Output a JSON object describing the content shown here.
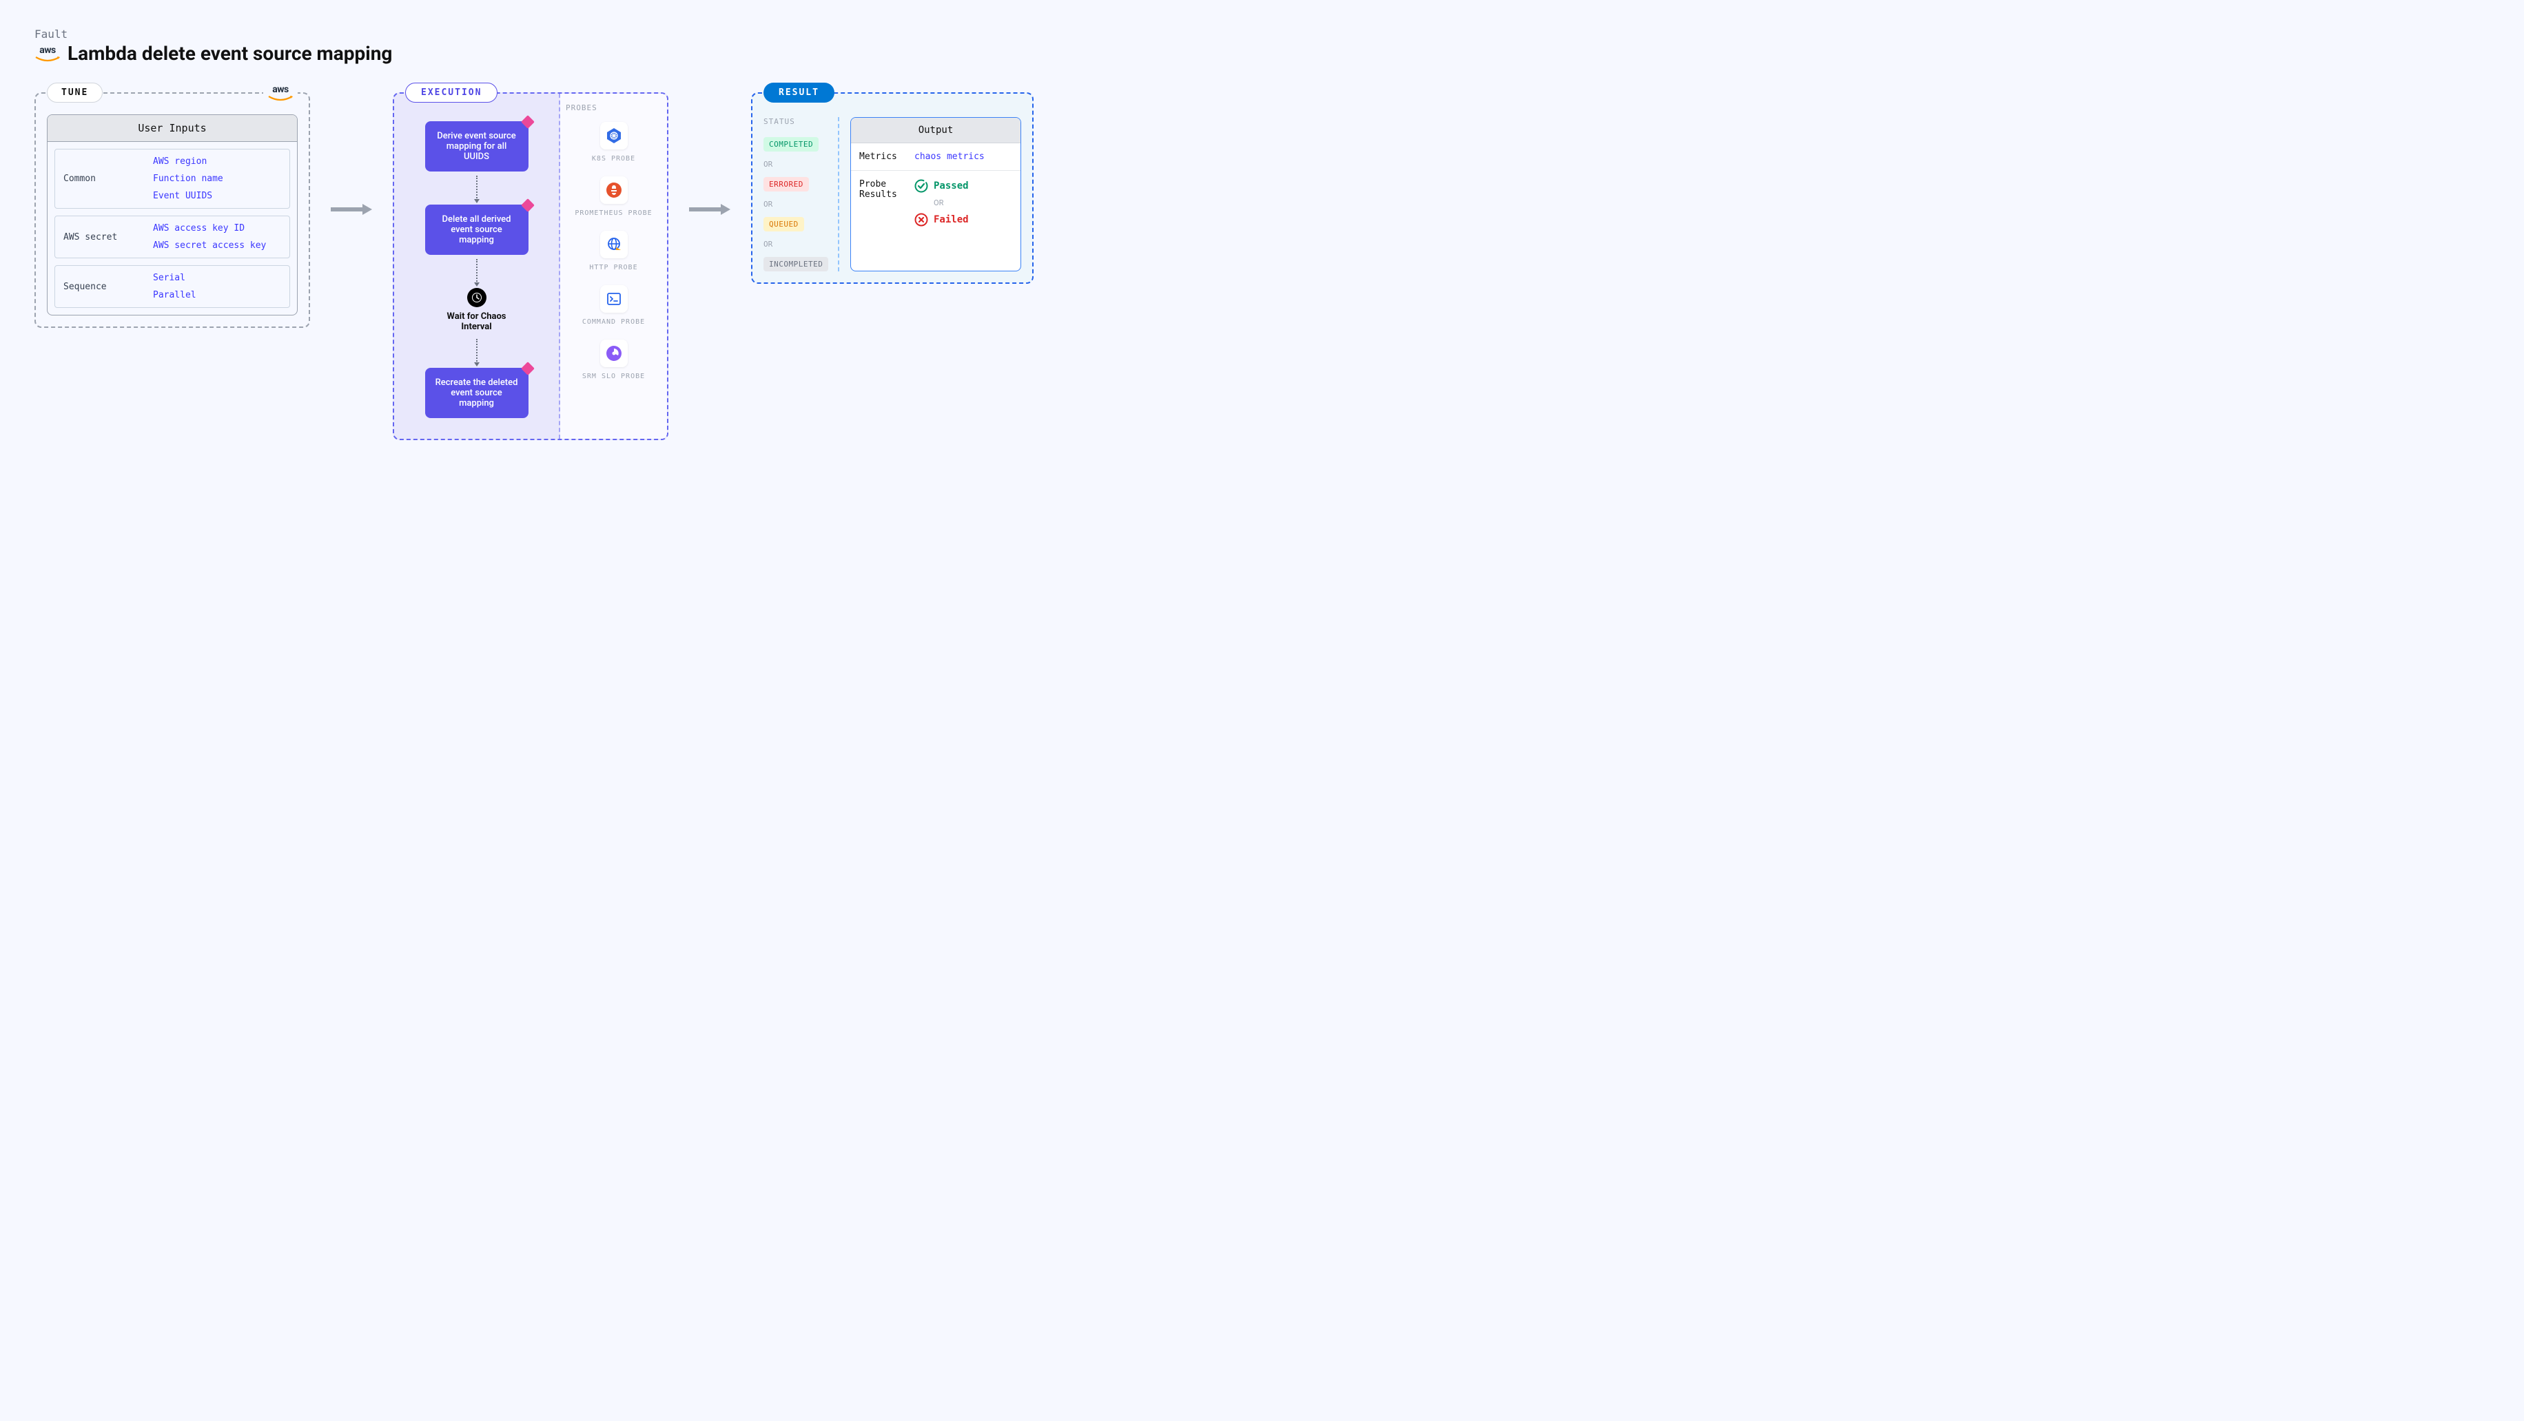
{
  "header": {
    "fault_label": "Fault",
    "title": "Lambda delete event source mapping",
    "aws_text": "aws"
  },
  "tune": {
    "badge": "TUNE",
    "inner_header": "User Inputs",
    "sections": [
      {
        "label": "Common",
        "values": [
          "AWS region",
          "Function name",
          "Event UUIDS"
        ]
      },
      {
        "label": "AWS secret",
        "values": [
          "AWS access key ID",
          "AWS secret access key"
        ]
      },
      {
        "label": "Sequence",
        "values": [
          "Serial",
          "Parallel"
        ]
      }
    ]
  },
  "execution": {
    "badge": "EXECUTION",
    "steps": [
      "Derive event source mapping for all UUIDS",
      "Delete all derived event source mapping",
      "Recreate the deleted event source mapping"
    ],
    "wait_label": "Wait for Chaos Interval",
    "probes_label": "PROBES",
    "probes": [
      {
        "name": "K8S PROBE",
        "icon": "k8s"
      },
      {
        "name": "PROMETHEUS PROBE",
        "icon": "prometheus"
      },
      {
        "name": "HTTP PROBE",
        "icon": "http"
      },
      {
        "name": "COMMAND PROBE",
        "icon": "command"
      },
      {
        "name": "SRM SLO PROBE",
        "icon": "srm"
      }
    ]
  },
  "result": {
    "badge": "RESULT",
    "status_label": "STATUS",
    "or_text": "OR",
    "statuses": [
      {
        "text": "COMPLETED",
        "class": "pill-completed"
      },
      {
        "text": "ERRORED",
        "class": "pill-errored"
      },
      {
        "text": "QUEUED",
        "class": "pill-queued"
      },
      {
        "text": "INCOMPLETED",
        "class": "pill-incompleted"
      }
    ],
    "output": {
      "header": "Output",
      "metrics_key": "Metrics",
      "metrics_val": "chaos metrics",
      "probe_results_key": "Probe Results",
      "passed": "Passed",
      "failed": "Failed"
    }
  }
}
